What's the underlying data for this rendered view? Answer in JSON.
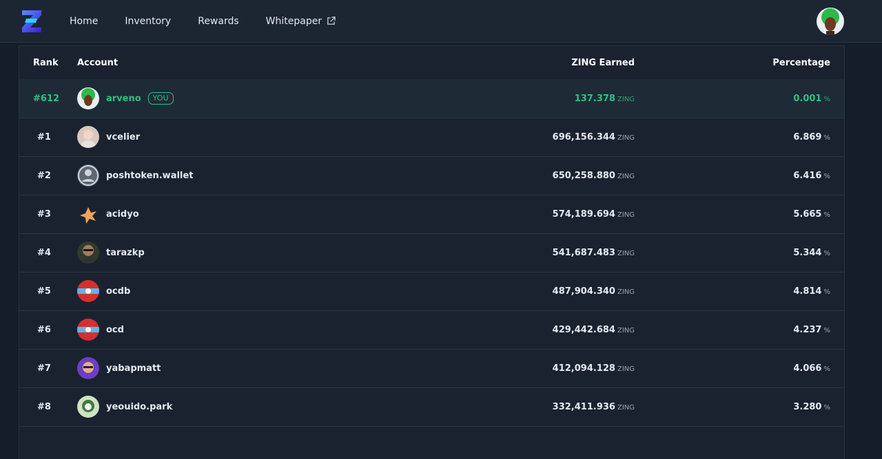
{
  "nav": {
    "home": "Home",
    "inventory": "Inventory",
    "rewards": "Rewards",
    "whitepaper": "Whitepaper"
  },
  "table": {
    "headers": {
      "rank": "Rank",
      "account": "Account",
      "earned": "ZING Earned",
      "percentage": "Percentage"
    },
    "unit": "ZING",
    "pct_unit": "%",
    "you_badge": "YOU",
    "current_user": {
      "rank": "#612",
      "account": "arveno",
      "earned": "137.378",
      "percentage": "0.001"
    },
    "rows": [
      {
        "rank": "#1",
        "account": "vcelier",
        "earned": "696,156.344",
        "percentage": "6.869"
      },
      {
        "rank": "#2",
        "account": "poshtoken.wallet",
        "earned": "650,258.880",
        "percentage": "6.416"
      },
      {
        "rank": "#3",
        "account": "acidyo",
        "earned": "574,189.694",
        "percentage": "5.665"
      },
      {
        "rank": "#4",
        "account": "tarazkp",
        "earned": "541,687.483",
        "percentage": "5.344"
      },
      {
        "rank": "#5",
        "account": "ocdb",
        "earned": "487,904.340",
        "percentage": "4.814"
      },
      {
        "rank": "#6",
        "account": "ocd",
        "earned": "429,442.684",
        "percentage": "4.237"
      },
      {
        "rank": "#7",
        "account": "yabapmatt",
        "earned": "412,094.128",
        "percentage": "4.066"
      },
      {
        "rank": "#8",
        "account": "yeouido.park",
        "earned": "332,411.936",
        "percentage": "3.280"
      }
    ]
  },
  "colors": {
    "accent": "#2ec27e",
    "background": "#151d28",
    "panel": "#1a2230"
  }
}
